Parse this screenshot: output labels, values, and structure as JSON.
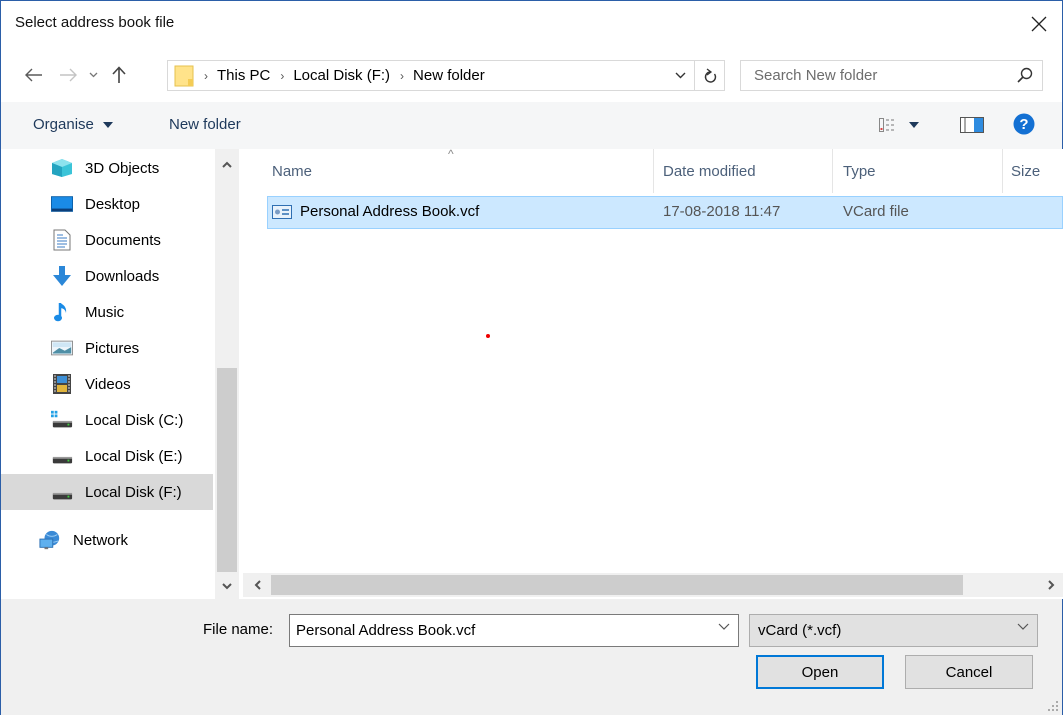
{
  "window": {
    "title": "Select address book file",
    "close_label": "Close"
  },
  "navigation": {
    "back_label": "Back",
    "forward_label": "Forward",
    "recent_label": "Recent locations",
    "up_label": "Up",
    "breadcrumb": [
      "This PC",
      "Local Disk (F:)",
      "New folder"
    ],
    "search_placeholder": "Search New folder"
  },
  "toolbar": {
    "organise_label": "Organise",
    "new_folder_label": "New folder",
    "icons": [
      "view-options-icon",
      "preview-pane-icon",
      "help-icon"
    ]
  },
  "sidebar": {
    "items": [
      {
        "label": "3D Objects",
        "icon": "3d-objects-icon",
        "selected": false
      },
      {
        "label": "Desktop",
        "icon": "desktop-icon",
        "selected": false
      },
      {
        "label": "Documents",
        "icon": "documents-icon",
        "selected": false
      },
      {
        "label": "Downloads",
        "icon": "downloads-icon",
        "selected": false
      },
      {
        "label": "Music",
        "icon": "music-icon",
        "selected": false
      },
      {
        "label": "Pictures",
        "icon": "pictures-icon",
        "selected": false
      },
      {
        "label": "Videos",
        "icon": "videos-icon",
        "selected": false
      },
      {
        "label": "Local Disk (C:)",
        "icon": "system-drive-icon",
        "selected": false
      },
      {
        "label": "Local Disk (E:)",
        "icon": "drive-icon",
        "selected": false
      },
      {
        "label": "Local Disk (F:)",
        "icon": "drive-icon",
        "selected": true
      },
      {
        "label": "Network",
        "icon": "network-icon",
        "selected": false
      }
    ]
  },
  "filelist": {
    "columns": [
      "Name",
      "Date modified",
      "Type",
      "Size"
    ],
    "sorted_by": "Name",
    "rows": [
      {
        "name": "Personal Address Book.vcf",
        "date_modified": "17-08-2018 11:47",
        "type": "VCard file",
        "size": "",
        "selected": true,
        "icon": "vcard-icon"
      }
    ]
  },
  "footer": {
    "file_name_label": "File name:",
    "file_name_value": "Personal Address Book.vcf",
    "file_type_value": "vCard (*.vcf)",
    "open_label": "Open",
    "cancel_label": "Cancel"
  },
  "colors": {
    "accent": "#0078d7",
    "selection_bg": "#cce8ff",
    "selection_border": "#99d1ff",
    "window_border": "#2b5ea8"
  }
}
